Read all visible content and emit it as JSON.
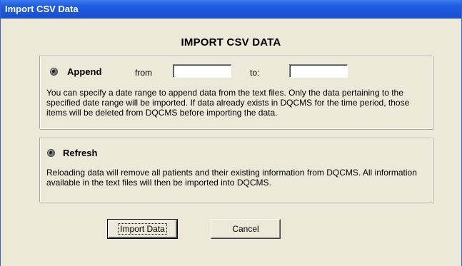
{
  "window": {
    "title": "Import CSV Data"
  },
  "heading": "IMPORT CSV DATA",
  "append": {
    "label": "Append",
    "from_label": "from",
    "from_value": "",
    "to_label": "to:",
    "to_value": "",
    "description": "You can specify a date range to append data from the text files. Only the data pertaining to the specified date range will be imported. If data already exists in DQCMS for the time period, those items will be deleted from DQCMS before importing the data."
  },
  "refresh": {
    "label": "Refresh",
    "description": "Reloading data will remove all patients and their existing information from DQCMS. All information available in the text files will then be imported into DQCMS."
  },
  "buttons": {
    "import_label": "Import Data",
    "cancel_label": "Cancel"
  },
  "colors": {
    "titlebar": "#1f5fe0",
    "dialog_bg": "#ece9d8"
  }
}
